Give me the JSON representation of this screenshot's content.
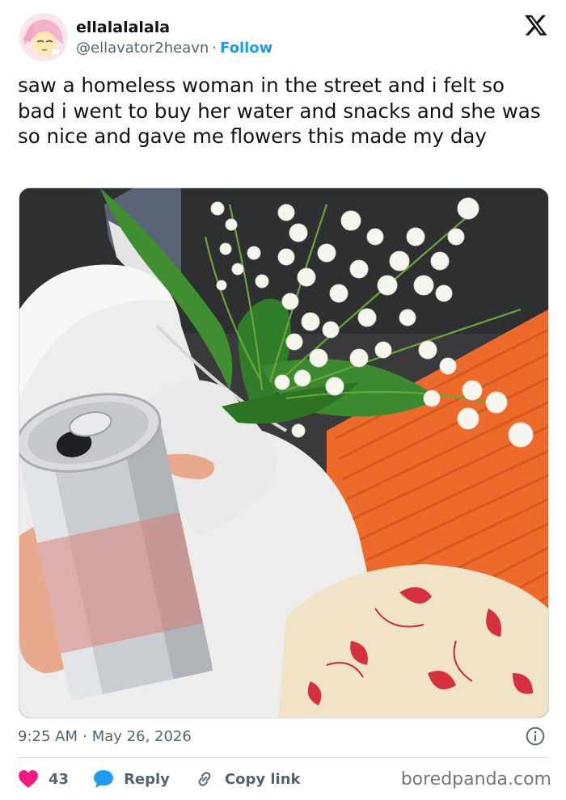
{
  "header": {
    "display_name": "ellalalalala",
    "handle": "@ellavator2heavn",
    "separator": "·",
    "follow_label": "Follow"
  },
  "tweet": {
    "text": "saw a homeless woman in the street and i felt so bad i went to buy her water and snacks and she was so nice and gave me flowers this made my day"
  },
  "meta": {
    "time": "9:25 AM",
    "separator": "·",
    "date": "May 26, 2026"
  },
  "actions": {
    "like_count": "43",
    "reply_label": "Reply",
    "copy_link_label": "Copy link"
  },
  "watermark": "boredpanda.com",
  "colors": {
    "accent": "#1d9bf0",
    "like": "#f91880",
    "muted": "#536471",
    "text": "#0f1419"
  },
  "icons": [
    "x-logo-icon",
    "info-icon",
    "heart-icon",
    "reply-bubble-icon",
    "link-icon"
  ]
}
